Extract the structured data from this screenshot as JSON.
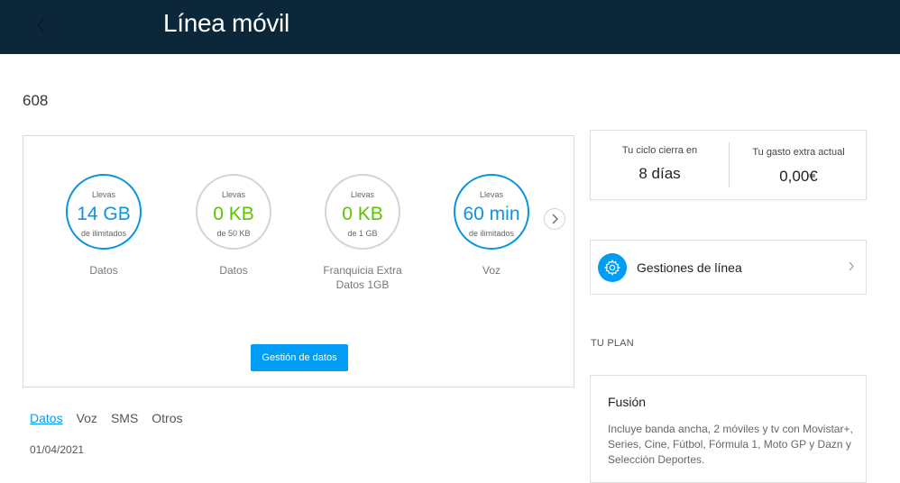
{
  "header": {
    "title": "Línea móvil",
    "back_icon": "chevron-left-icon"
  },
  "line": {
    "number": "608"
  },
  "usage": {
    "items": [
      {
        "top": "Llevas",
        "amount": "14 GB",
        "bottom": "de ilimitados",
        "label": "Datos",
        "ring_color": "#0b94df",
        "amount_color": "#0b94df"
      },
      {
        "top": "Llevas",
        "amount": "0 KB",
        "bottom": "de 50 KB",
        "label": "Datos",
        "ring_color": "#d4d4d4",
        "amount_color": "#5bc500"
      },
      {
        "top": "Llevas",
        "amount": "0 KB",
        "bottom": "de 1 GB",
        "label": "Franquicia Extra Datos 1GB",
        "ring_color": "#d4d4d4",
        "amount_color": "#5bc500"
      },
      {
        "top": "Llevas",
        "amount": "60 min",
        "bottom": "de ilimitados",
        "label": "Voz",
        "ring_color": "#0b94df",
        "amount_color": "#0b94df"
      }
    ],
    "next_icon": "chevron-right-icon",
    "button_label": "Gestión de datos"
  },
  "tabs": [
    {
      "label": "Datos",
      "active": true
    },
    {
      "label": "Voz",
      "active": false
    },
    {
      "label": "SMS",
      "active": false
    },
    {
      "label": "Otros",
      "active": false
    }
  ],
  "date": "01/04/2021",
  "cycle": {
    "close_caption": "Tu ciclo cierra en",
    "close_value": "8 días",
    "extra_caption": "Tu gasto extra actual",
    "extra_value": "0,00€"
  },
  "gestiones": {
    "label": "Gestiones de línea",
    "icon": "gear-icon",
    "chevron_icon": "chevron-right-icon"
  },
  "plan": {
    "heading": "TU PLAN",
    "name": "Fusión",
    "description": "Incluye banda ancha, 2 móviles y tv con Movistar+, Series, Cine, Fútbol, Fórmula 1, Moto GP y Dazn y Selección Deportes."
  },
  "colors": {
    "header_bg": "#0b2739",
    "accent": "#019df4",
    "green": "#5bc500"
  }
}
